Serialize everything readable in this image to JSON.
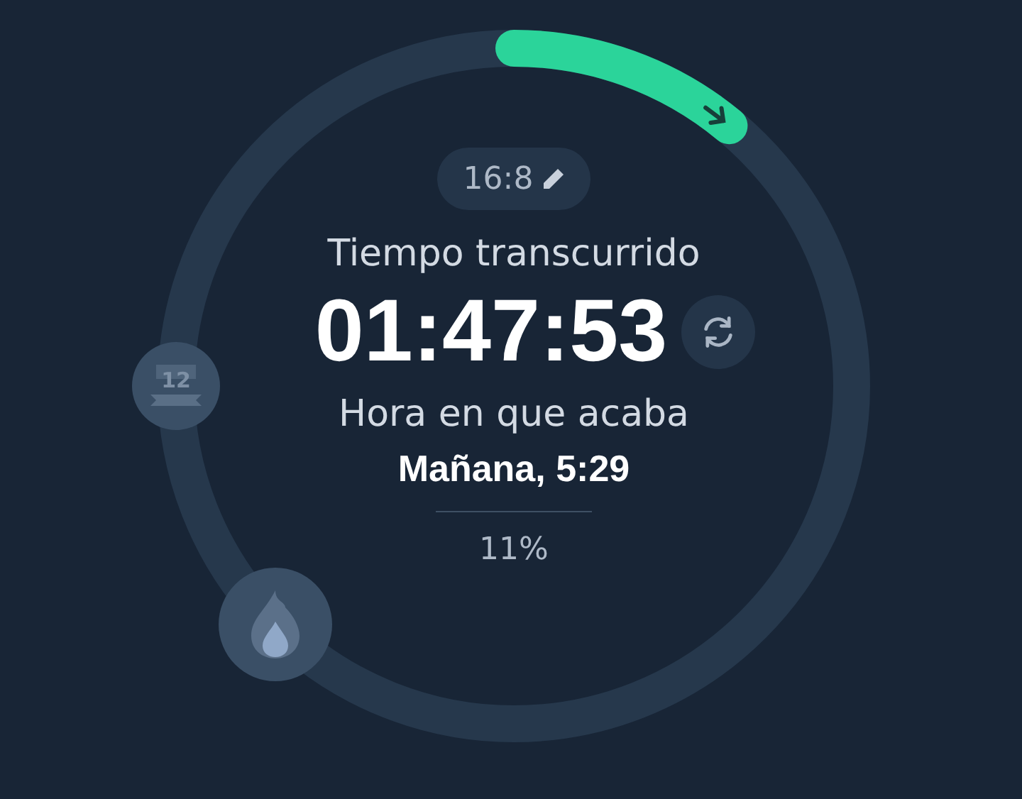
{
  "fasting_plan": {
    "label": "16:8"
  },
  "elapsed_label": "Tiempo transcurrido",
  "elapsed_time": "01:47:53",
  "end_label": "Hora en que acaba",
  "end_time": "Mañana, 5:29",
  "progress": {
    "reading": "11%"
  },
  "milestones": [
    {
      "kind": "badge",
      "label": "12"
    },
    {
      "kind": "flame"
    }
  ]
}
